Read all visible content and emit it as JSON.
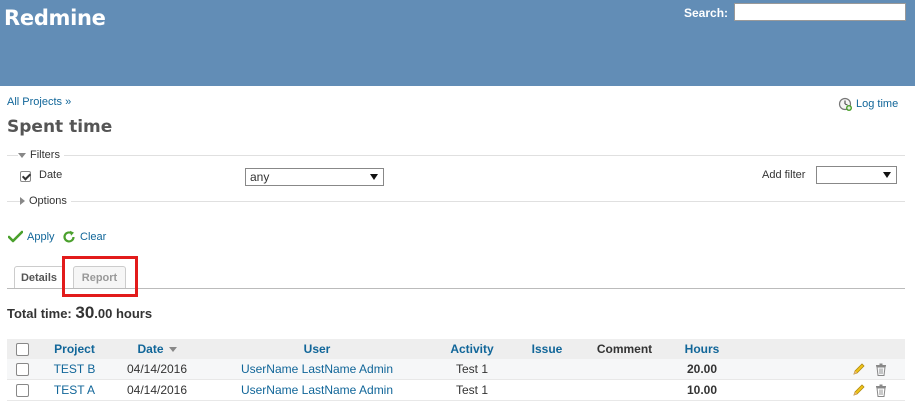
{
  "header": {
    "app_title": "Redmine",
    "search_label": "Search:",
    "search_value": ""
  },
  "breadcrumb": "All Projects »",
  "log_time_label": "Log time",
  "page_title": "Spent time",
  "filters": {
    "legend": "Filters",
    "date_label": "Date",
    "date_operator": "any",
    "add_filter_label": "Add filter",
    "add_filter_value": ""
  },
  "options_legend": "Options",
  "buttons": {
    "apply": "Apply",
    "clear": "Clear"
  },
  "tabs": {
    "details": "Details",
    "report": "Report"
  },
  "total_time": {
    "prefix": "Total time: ",
    "value": "30",
    "decimals": ".00",
    "unit": " hours"
  },
  "table": {
    "headers": {
      "project": "Project",
      "date": "Date",
      "user": "User",
      "activity": "Activity",
      "issue": "Issue",
      "comment": "Comment",
      "hours": "Hours"
    },
    "rows": [
      {
        "project": "TEST B",
        "date": "04/14/2016",
        "user": "UserName LastName Admin",
        "activity": "Test 1",
        "issue": "",
        "comment": "",
        "hours": "20.00"
      },
      {
        "project": "TEST A",
        "date": "04/14/2016",
        "user": "UserName LastName Admin",
        "activity": "Test 1",
        "issue": "",
        "comment": "",
        "hours": "10.00"
      }
    ]
  },
  "colors": {
    "header_bg": "#628db6",
    "link": "#116699",
    "highlight": "#e21b1b",
    "apply_icon": "#4aa02c"
  }
}
